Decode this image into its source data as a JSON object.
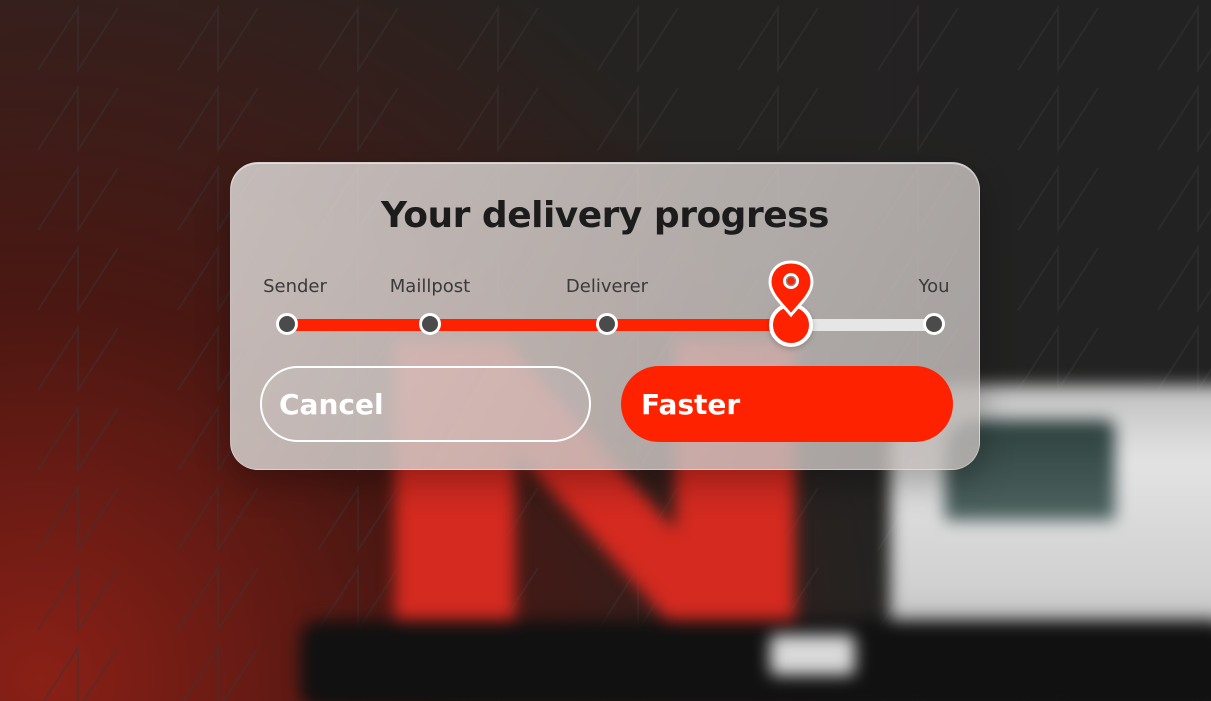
{
  "dialog": {
    "title": "Your delivery progress",
    "progress_fraction": 0.78
  },
  "steps": [
    {
      "label": "Sender",
      "status": "done"
    },
    {
      "label": "Maillpost",
      "status": "done"
    },
    {
      "label": "Deliverer",
      "status": "done"
    },
    {
      "label": "",
      "status": "current"
    },
    {
      "label": "You",
      "status": "pending"
    }
  ],
  "current_marker_icon": "location-pin-icon",
  "buttons": {
    "cancel_label": "Cancel",
    "faster_label": "Faster"
  },
  "colors": {
    "accent": "#ff2200",
    "track_inactive": "#e6e6e6",
    "dot_inactive": "#4b4b4b",
    "title_text": "#1c1c1c"
  }
}
